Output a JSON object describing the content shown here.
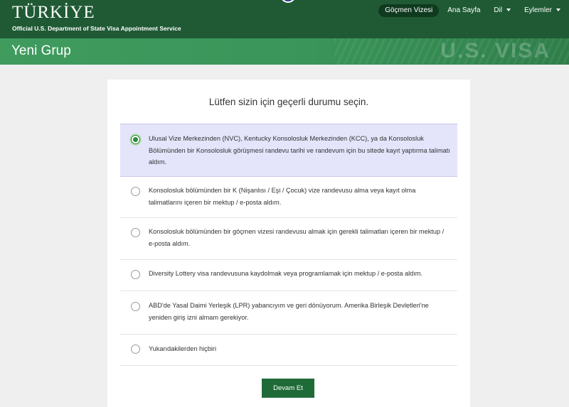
{
  "header": {
    "title": "TÜRKİYE",
    "subtitle": "Official U.S. Department of State Visa Appointment Service",
    "nav": [
      {
        "label": "Göçmen Vizesi",
        "active": true,
        "dropdown": false
      },
      {
        "label": "Ana Sayfa",
        "active": false,
        "dropdown": false
      },
      {
        "label": "Dil",
        "active": false,
        "dropdown": true
      },
      {
        "label": "Eylemler",
        "active": false,
        "dropdown": true
      }
    ]
  },
  "subheader": {
    "title": "Yeni Grup",
    "watermark": "U.S. VISA"
  },
  "form": {
    "prompt": "Lütfen sizin için geçerli durumu seçin.",
    "options": [
      {
        "label": "Ulusal Vize Merkezinden (NVC), Kentucky Konsolosluk Merkezinden (KCC), ya da Konsolosluk Bölümünden bir Konsolosluk görüşmesi randevu tarihi ve randevum için bu sitede kayıt yaptırma talimatı aldım.",
        "selected": true
      },
      {
        "label": "Konsolosluk bölümünden bir K (Nişanlısı / Eşi / Çocuk) vize randevusu alma veya kayıt olma talimatlarını içeren bir mektup / e-posta aldım.",
        "selected": false
      },
      {
        "label": "Konsolosluk bölümünden bir göçmen vizesi randevusu almak için gerekli talimatları içeren bir mektup / e-posta aldım.",
        "selected": false
      },
      {
        "label": "Diversity Lottery visa randevusuna kaydolmak veya programlamak için mektup / e-posta aldım.",
        "selected": false
      },
      {
        "label": "ABD'de Yasal Daimi Yerleşik (LPR) yabancıyım ve geri dönüyorum. Amerika Birleşik Devletleri'ne yeniden giriş izni almam gerekiyor.",
        "selected": false
      },
      {
        "label": "Yukarıdakilerden hiçbiri",
        "selected": false
      }
    ],
    "submit_label": "Devam Et"
  },
  "colors": {
    "header_bg": "#1f5a34",
    "subheader_bg": "#3f9b5e",
    "selected_bg": "#e4e4fb",
    "button_bg": "#1f6b38"
  }
}
